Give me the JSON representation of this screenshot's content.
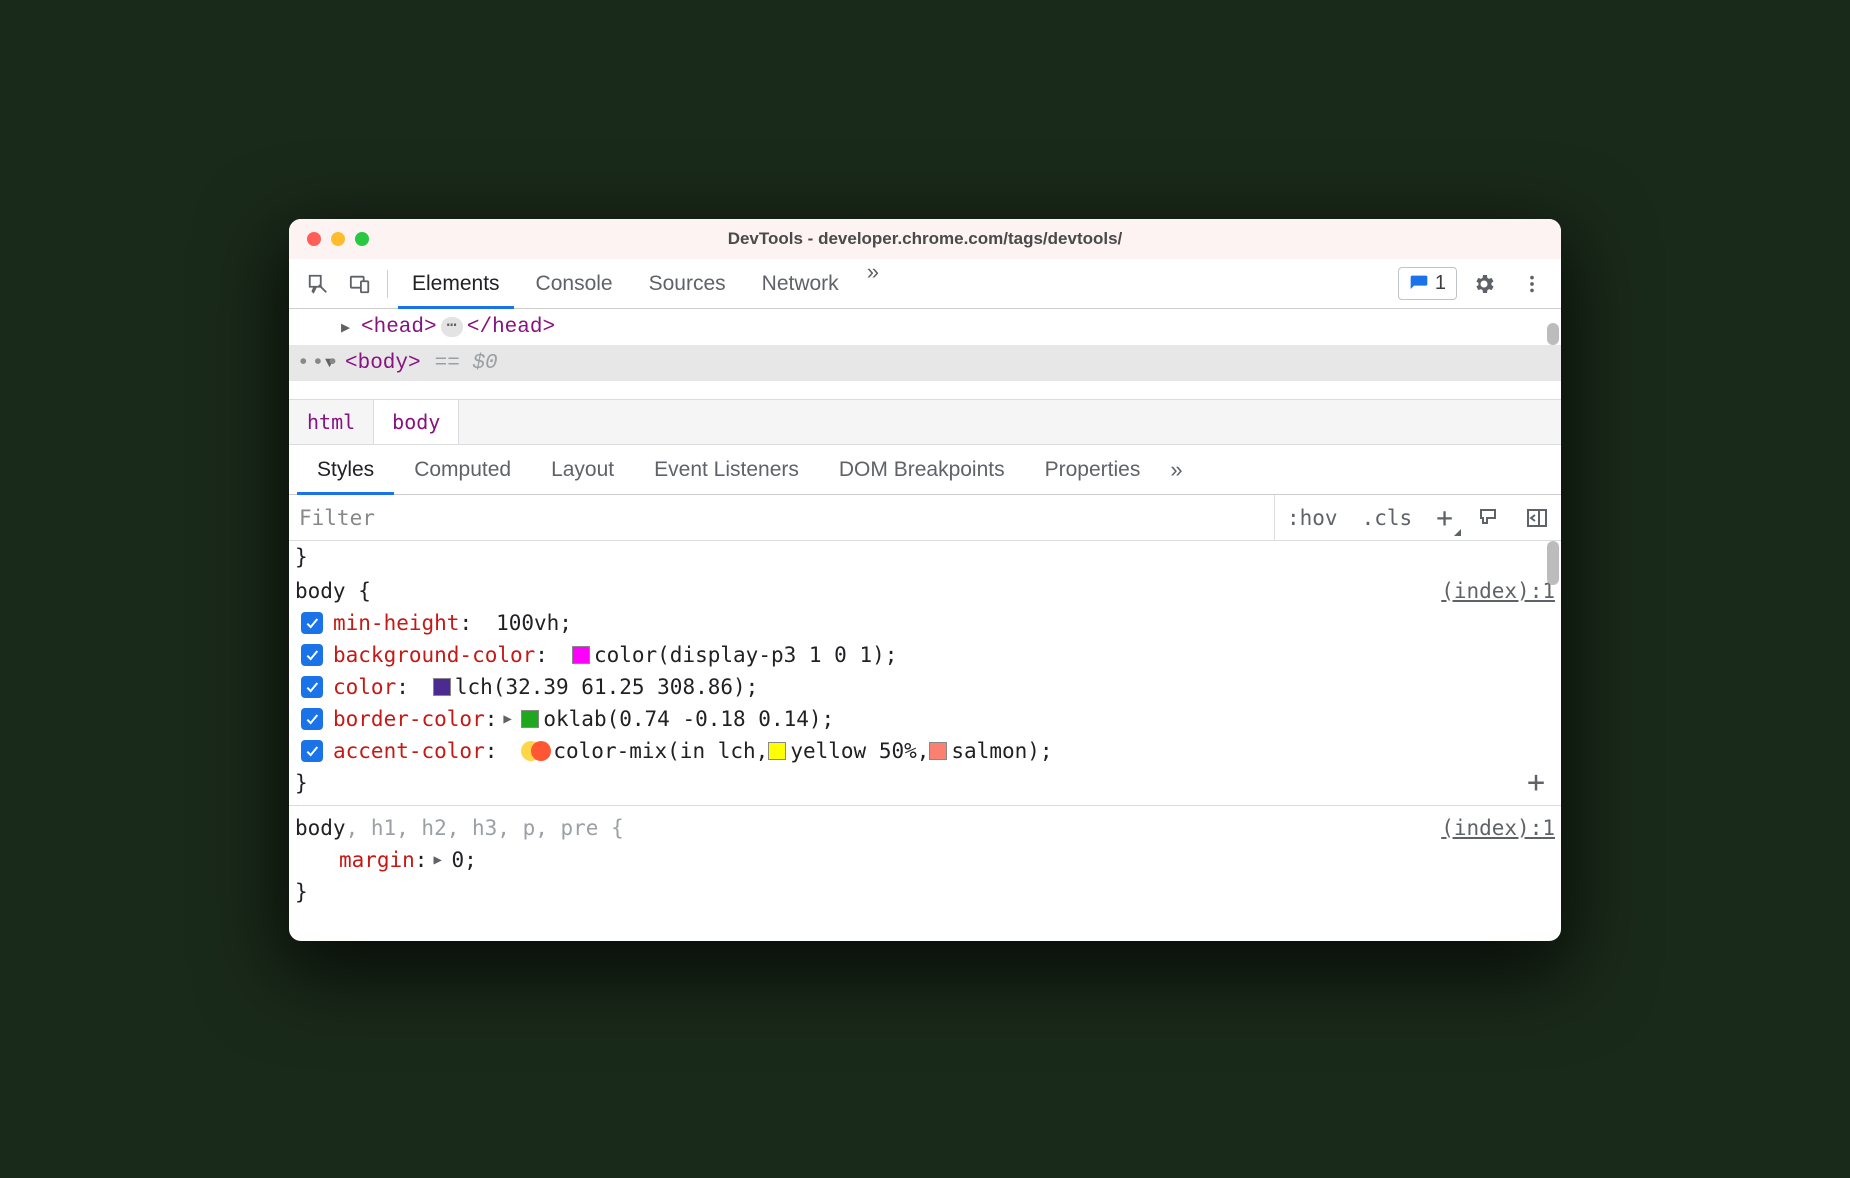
{
  "window": {
    "title": "DevTools - developer.chrome.com/tags/devtools/"
  },
  "toolbar": {
    "tabs": [
      "Elements",
      "Console",
      "Sources",
      "Network"
    ],
    "active_tab_index": 0,
    "issues_count": "1"
  },
  "dom_tree": {
    "row0_open": "<head>",
    "row0_close": "</head>",
    "row1_open": "<body>",
    "row1_eq": "== $0"
  },
  "breadcrumbs": [
    "html",
    "body"
  ],
  "styles_tabs": {
    "tabs": [
      "Styles",
      "Computed",
      "Layout",
      "Event Listeners",
      "DOM Breakpoints",
      "Properties"
    ],
    "active_index": 0
  },
  "filter": {
    "placeholder": "Filter",
    "hov": ":hov",
    "cls": ".cls"
  },
  "rules": [
    {
      "prelude_close": "}",
      "selector_html": "body {",
      "origin": "(index):1",
      "declarations": [
        {
          "name": "min-height",
          "value_text": "100vh",
          "has_expand": false,
          "swatches": []
        },
        {
          "name": "background-color",
          "value_text": "color(display-p3 1 0 1)",
          "has_expand": false,
          "swatches": [
            {
              "color": "#ff00ff"
            }
          ]
        },
        {
          "name": "color",
          "value_text": "lch(32.39 61.25 308.86)",
          "has_expand": false,
          "swatches": [
            {
              "color": "#4b2b8f"
            }
          ]
        },
        {
          "name": "border-color",
          "value_text": "oklab(0.74 -0.18 0.14)",
          "has_expand": true,
          "swatches": [
            {
              "color": "#1fa81f"
            }
          ]
        },
        {
          "name": "accent-color",
          "value_text_prefix": "color-mix(in lch, ",
          "value_text_mid1": "yellow 50%, ",
          "value_text_mid2": "salmon",
          "value_text_suffix": ")",
          "has_expand": false,
          "swatch_pair": true,
          "mid_swatches": [
            {
              "color": "#ffff00"
            },
            {
              "color": "#fa8072"
            }
          ]
        }
      ]
    },
    {
      "selector_main": "body",
      "selector_rest": ", h1, h2, h3, p, pre {",
      "origin": "(index):1",
      "declarations": [
        {
          "name": "margin",
          "value_text": "0",
          "has_expand": true,
          "swatches": [],
          "no_check": true
        }
      ]
    }
  ]
}
